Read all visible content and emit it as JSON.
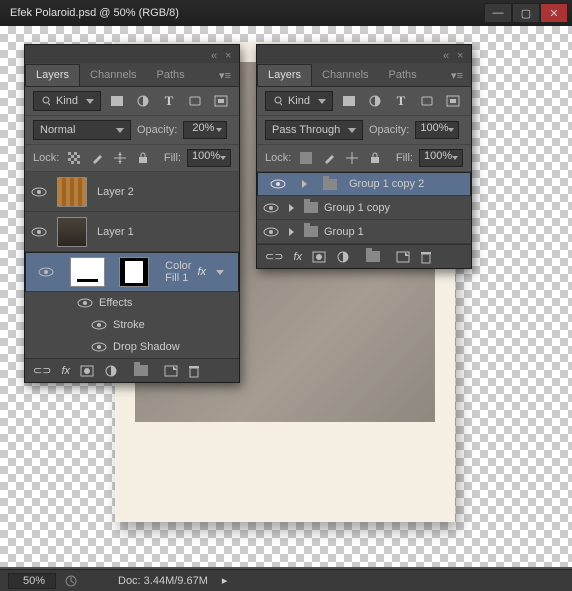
{
  "title": "Efek Polaroid.psd @ 50% (RGB/8)",
  "status": {
    "zoom": "50%",
    "doc": "Doc: 3.44M/9.67M"
  },
  "panel_tabs": {
    "layers": "Layers",
    "channels": "Channels",
    "paths": "Paths"
  },
  "filter_label": "Kind",
  "blend_left": "Normal",
  "blend_right": "Pass Through",
  "opacity_label": "Opacity:",
  "opacity_left": "20%",
  "opacity_right": "100%",
  "lock_label": "Lock:",
  "fill_label": "Fill:",
  "fill_left": "100%",
  "fill_right": "100%",
  "layers_left": [
    {
      "name": "Layer 2"
    },
    {
      "name": "Layer 1"
    },
    {
      "name": "Color Fill 1"
    }
  ],
  "fx_header": "Effects",
  "fx_items": [
    "Stroke",
    "Drop Shadow"
  ],
  "groups_right": [
    "Group 1 copy 2",
    "Group 1 copy",
    "Group 1"
  ]
}
